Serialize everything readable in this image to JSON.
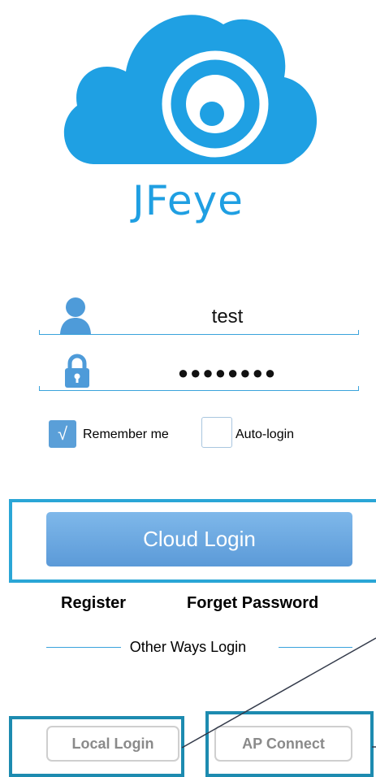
{
  "brand": {
    "name": "JFeye",
    "color": "#1f9fe2"
  },
  "login": {
    "username_value": "test",
    "password_mask": "●●●●●●●●",
    "user_icon": "user-icon",
    "lock_icon": "lock-icon"
  },
  "options": {
    "remember_label": "Remember me",
    "remember_checked": true,
    "remember_check_glyph": "√",
    "autologin_label": "Auto-login",
    "autologin_checked": false
  },
  "actions": {
    "cloud_login_label": "Cloud Login",
    "register_label": "Register",
    "forget_password_label": "Forget Password"
  },
  "other_ways": {
    "title": "Other Ways Login",
    "local_login_label": "Local Login",
    "ap_connect_label": "AP Connect"
  },
  "colors": {
    "accent": "#3aa3dc",
    "button": "#6aa8e0",
    "highlight": "#2aa6d6"
  }
}
